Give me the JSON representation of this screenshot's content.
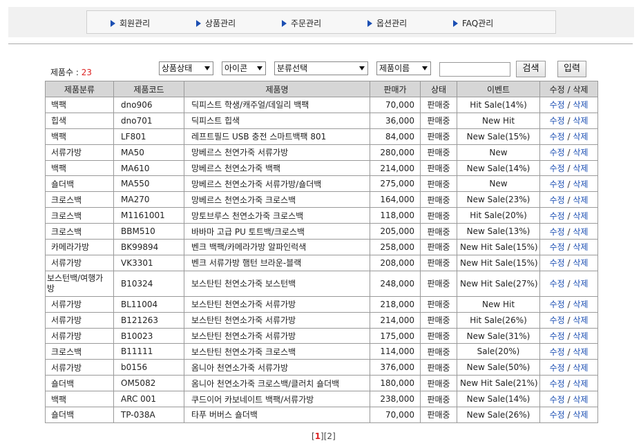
{
  "nav": {
    "items": [
      {
        "label": "회원관리"
      },
      {
        "label": "상품관리"
      },
      {
        "label": "주문관리"
      },
      {
        "label": "옵션관리"
      },
      {
        "label": "FAQ관리"
      }
    ]
  },
  "summary": {
    "count_label": "제품수 : ",
    "count_value": "23"
  },
  "filters": {
    "status": "상품상태",
    "icon": "아이콘",
    "category": "분류선택",
    "field": "제품이름",
    "search_value": "",
    "search_button": "검색",
    "input_button": "입력"
  },
  "table": {
    "headers": [
      "제품분류",
      "제품코드",
      "제품명",
      "판매가",
      "상태",
      "이벤트",
      "수정 / 삭제"
    ],
    "edit_label": "수정",
    "delete_label": "삭제",
    "sep": " / ",
    "rows": [
      {
        "category": "백팩",
        "code": "dno906",
        "name": "딕피스트 학생/캐주얼/데일리 백팩",
        "price": "70,000",
        "status": "판매중",
        "event": "Hit Sale(14%)"
      },
      {
        "category": "힙색",
        "code": "dno701",
        "name": "딕피스트 힙색",
        "price": "36,000",
        "status": "판매중",
        "event": "New Hit"
      },
      {
        "category": "백팩",
        "code": "LF801",
        "name": "레프트필드 USB 충전 스마트백팩 801",
        "price": "84,000",
        "status": "판매중",
        "event": "New Sale(15%)"
      },
      {
        "category": "서류가방",
        "code": "MA50",
        "name": "망베르스 천연가죽 서류가방",
        "price": "280,000",
        "status": "판매중",
        "event": "New"
      },
      {
        "category": "백팩",
        "code": "MA610",
        "name": "망베르스 천연소가죽 백팩",
        "price": "214,000",
        "status": "판매중",
        "event": "New Sale(14%)"
      },
      {
        "category": "숄더백",
        "code": "MA550",
        "name": "망베르스 천연소가죽 서류가방/숄더백",
        "price": "275,000",
        "status": "판매중",
        "event": "New"
      },
      {
        "category": "크로스백",
        "code": "MA270",
        "name": "망베르스 천연소가죽 크로스백",
        "price": "164,000",
        "status": "판매중",
        "event": "New Sale(23%)"
      },
      {
        "category": "크로스백",
        "code": "M1161001",
        "name": "망토브루스 천연소가죽 크로스백",
        "price": "118,000",
        "status": "판매중",
        "event": "Hit Sale(20%)"
      },
      {
        "category": "크로스백",
        "code": "BBM510",
        "name": "바바마 고급 PU 토트백/크로스백",
        "price": "205,000",
        "status": "판매중",
        "event": "New Sale(13%)"
      },
      {
        "category": "카메라가방",
        "code": "BK99894",
        "name": "벤크 백팩/카메라가방 알파인럭색",
        "price": "258,000",
        "status": "판매중",
        "event": "New Hit Sale(15%)"
      },
      {
        "category": "서류가방",
        "code": "VK3301",
        "name": "벤크 서류가방 햄턴 브라운-블랙",
        "price": "208,000",
        "status": "판매중",
        "event": "New Hit Sale(15%)"
      },
      {
        "category": "보스턴백/여행가방",
        "code": "B10324",
        "name": "보스탄틴 천연소가죽 보스턴백",
        "price": "248,000",
        "status": "판매중",
        "event": "New Hit Sale(27%)"
      },
      {
        "category": "서류가방",
        "code": "BL11004",
        "name": "보스탄틴 천연소가죽 서류가방",
        "price": "218,000",
        "status": "판매중",
        "event": "New Hit"
      },
      {
        "category": "서류가방",
        "code": "B121263",
        "name": "보스탄틴 천연소가죽 서류가방",
        "price": "214,000",
        "status": "판매중",
        "event": "Hit Sale(26%)"
      },
      {
        "category": "서류가방",
        "code": "B10023",
        "name": "보스탄틴 천연소가죽 서류가방",
        "price": "175,000",
        "status": "판매중",
        "event": "New Sale(31%)"
      },
      {
        "category": "크로스백",
        "code": "B11111",
        "name": "보스탄틴 천연소가죽 크로스백",
        "price": "114,000",
        "status": "판매중",
        "event": "Sale(20%)"
      },
      {
        "category": "서류가방",
        "code": "b0156",
        "name": "옴니아 천연소가죽 서류가방",
        "price": "376,000",
        "status": "판매중",
        "event": "New Sale(50%)"
      },
      {
        "category": "숄더백",
        "code": "OM5082",
        "name": "옴니아 천연소가죽 크로스백/클러치 숄더백",
        "price": "180,000",
        "status": "판매중",
        "event": "New Hit Sale(21%)"
      },
      {
        "category": "백팩",
        "code": "ARC 001",
        "name": "쿠드이어 카보네이트 백팩/서류가방",
        "price": "238,000",
        "status": "판매중",
        "event": "New Sale(14%)"
      },
      {
        "category": "숄더백",
        "code": "TP-038A",
        "name": "타푸 버버스 숄더백",
        "price": "70,000",
        "status": "판매중",
        "event": "New Sale(26%)"
      }
    ]
  },
  "pagination": {
    "pages": [
      "1",
      "2"
    ],
    "current": "1"
  }
}
